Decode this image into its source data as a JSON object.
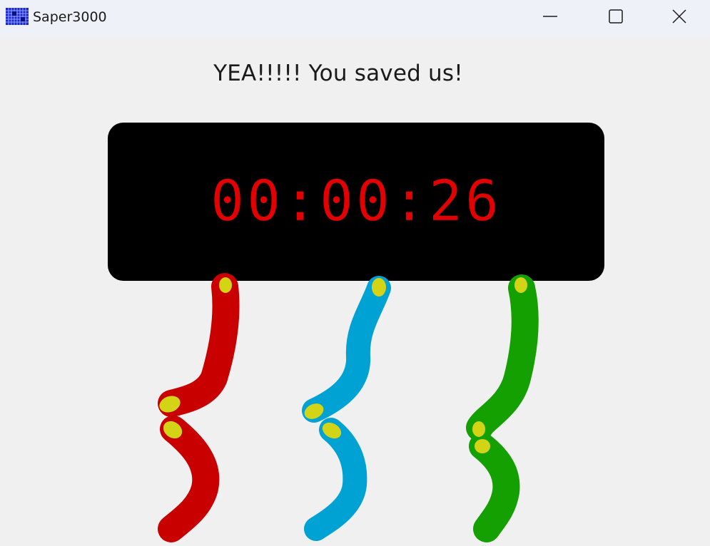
{
  "window": {
    "title": "Saper3000",
    "icon": "grid-app-icon",
    "controls": [
      "minimize-icon",
      "maximize-icon",
      "close-icon"
    ]
  },
  "game": {
    "message": "YEA!!!!! You saved us!",
    "timer": "00:00:26",
    "timer_color": "#e30000",
    "panel_color": "#000000",
    "wires": [
      {
        "color_name": "red",
        "color": "#c80000",
        "state": "cut"
      },
      {
        "color_name": "blue",
        "color": "#00a2d4",
        "state": "cut"
      },
      {
        "color_name": "green",
        "color": "#14a000",
        "state": "cut"
      }
    ],
    "wire_tip_color": "#d4d417"
  }
}
